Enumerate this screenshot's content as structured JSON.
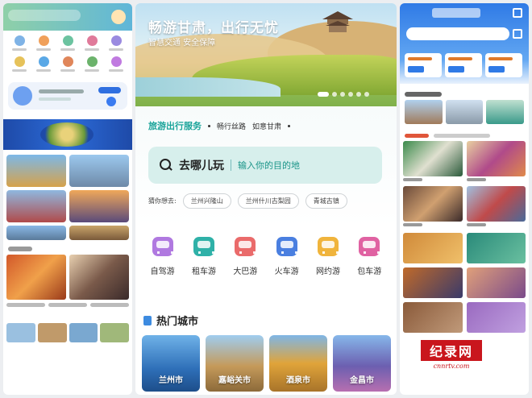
{
  "hero": {
    "title": "畅游甘肃，出行无忧",
    "subtitle": "智慧交通 安全保障"
  },
  "service": {
    "tab_main": "旅游出行服务",
    "tabs": [
      "畅行丝路",
      "如意甘肃"
    ],
    "search_main": "去哪儿玩",
    "search_placeholder": "输入你的目的地",
    "guess_label": "猜你想去:",
    "guess_chips": [
      "兰州兴隆山",
      "兰州什川古梨园",
      "青城古镇"
    ]
  },
  "transport": [
    {
      "label": "自驾游",
      "color": "#b079e0",
      "icon": "car-icon"
    },
    {
      "label": "租车游",
      "color": "#2fb1a8",
      "icon": "rental-car-icon"
    },
    {
      "label": "大巴游",
      "color": "#ea6b6b",
      "icon": "bus-icon"
    },
    {
      "label": "火车游",
      "color": "#4a7fe0",
      "icon": "train-icon"
    },
    {
      "label": "网约游",
      "color": "#f0b43c",
      "icon": "ride-hailing-icon"
    },
    {
      "label": "包车游",
      "color": "#e062a2",
      "icon": "charter-bus-icon"
    }
  ],
  "hot_cities": {
    "title": "热门城市",
    "cities": [
      {
        "name": "兰州市",
        "bg": "linear-gradient(180deg,#6fb2e8,#2e6fb8 60%,#1d4e8a)"
      },
      {
        "name": "嘉峪关市",
        "bg": "linear-gradient(180deg,#9fcdf0,#c59a5a 55%,#8c6a3a)"
      },
      {
        "name": "酒泉市",
        "bg": "linear-gradient(180deg,#7fb6e6,#e0a43a 50%,#a8742a)"
      },
      {
        "name": "金昌市",
        "bg": "linear-gradient(180deg,#86b7ea,#6c5fb0 55%,#b76fb0)"
      }
    ]
  },
  "watermark": {
    "text": "纪录网",
    "url": "cnnrtv.com"
  }
}
